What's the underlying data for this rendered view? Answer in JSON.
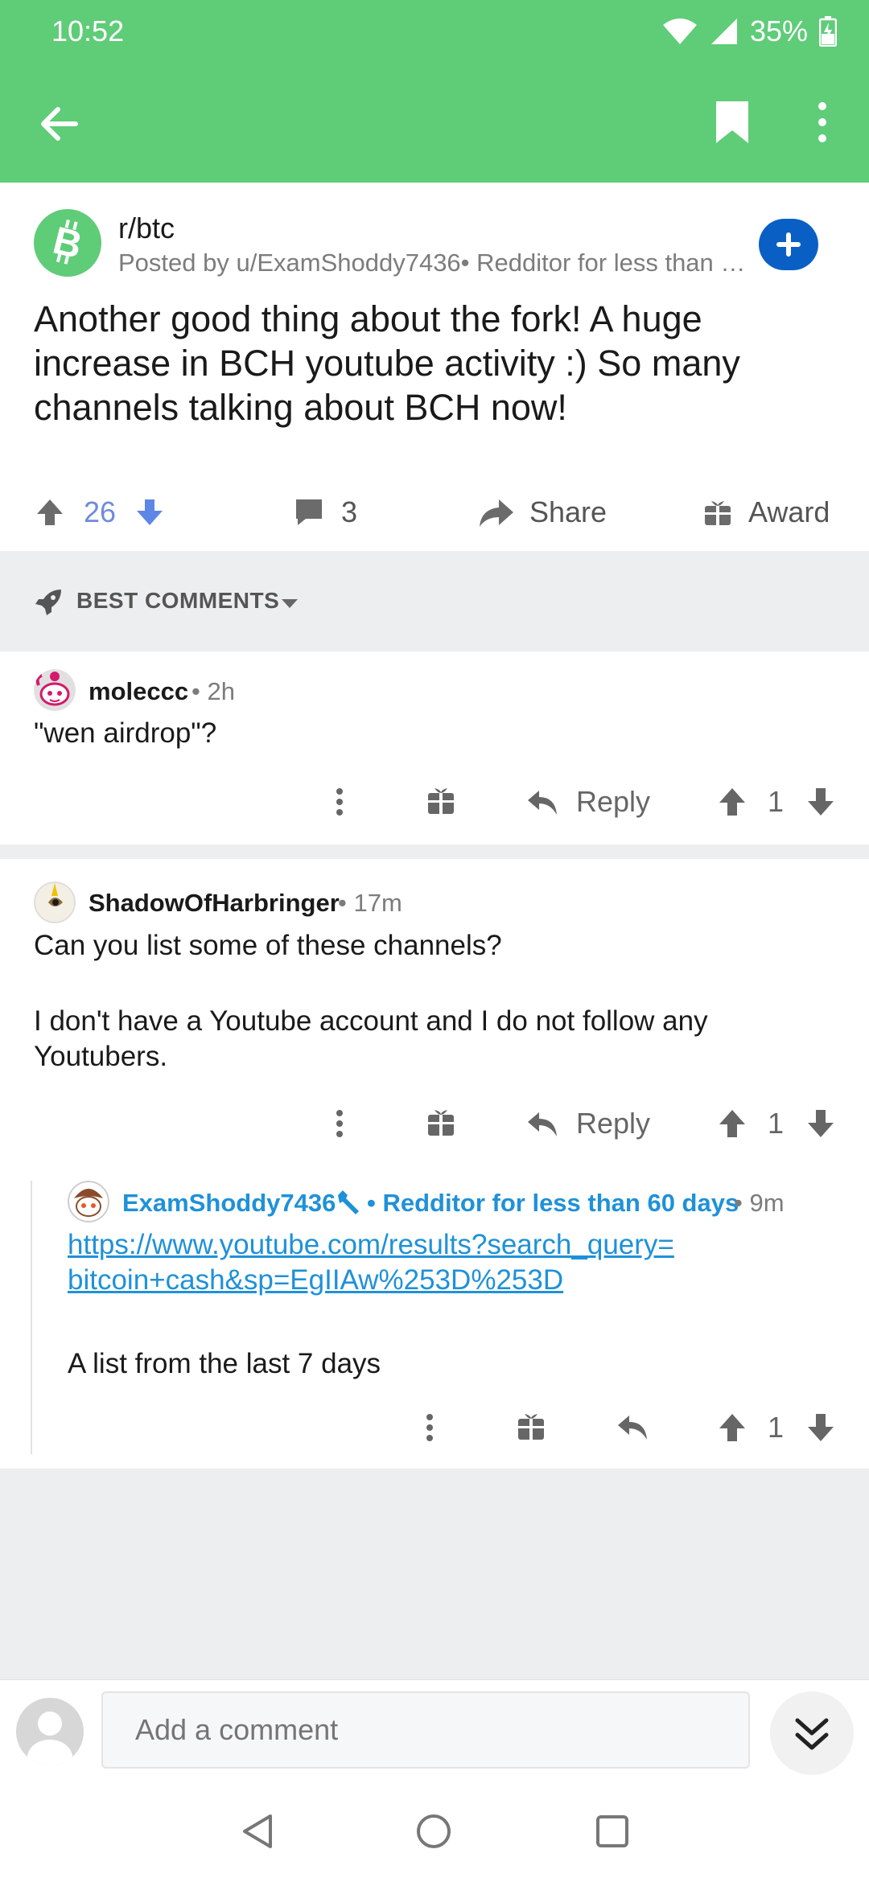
{
  "status_bar": {
    "time": "10:52",
    "battery": "35%"
  },
  "toolbar": {
    "icons": [
      "back-arrow-icon",
      "bookmark-icon",
      "more-vert-icon"
    ]
  },
  "post": {
    "subreddit": "r/btc",
    "posted_by": "Posted by u/ExamShoddy7436• Redditor for less than 60 days",
    "title": "Another good thing about the fork! A huge increase in BCH youtube activity :) So many channels talking about BCH now!",
    "score": "26",
    "comments": "3",
    "share_label": "Share",
    "award_label": "Award"
  },
  "sort": {
    "label": "BEST COMMENTS"
  },
  "comments": [
    {
      "author": "moleccc",
      "meta": "• 2h",
      "body": "\"wen airdrop\"?",
      "reply_label": "Reply",
      "score": "1"
    },
    {
      "author": "ShadowOfHarbringer",
      "meta": "• 17m",
      "body_line1": "Can you list some of these channels?",
      "body_line2": "I don't have a Youtube account and I do not follow any Youtubers.",
      "reply_label": "Reply",
      "score": "1"
    },
    {
      "author": "ExamShoddy7436",
      "flair": "• Redditor for less than 60 days",
      "meta": "• 9m",
      "link": "https://www.youtube.com/results?search_query=bitcoin+cash&sp=EgIIAw%253D%253D",
      "link_line1": "https://www.youtube.com/results?search_query=",
      "link_line2": "bitcoin+cash&sp=EgIIAw%253D%253D",
      "body": "A list from the last 7 days",
      "score": "1"
    }
  ],
  "composer": {
    "placeholder": "Add a comment"
  },
  "colors": {
    "app_bar": "#5fcc78",
    "upvote_blue": "#6e8bdb",
    "join_blue": "#0a5fc4",
    "link": "#1f91d8",
    "background_gray": "#eceeef"
  }
}
